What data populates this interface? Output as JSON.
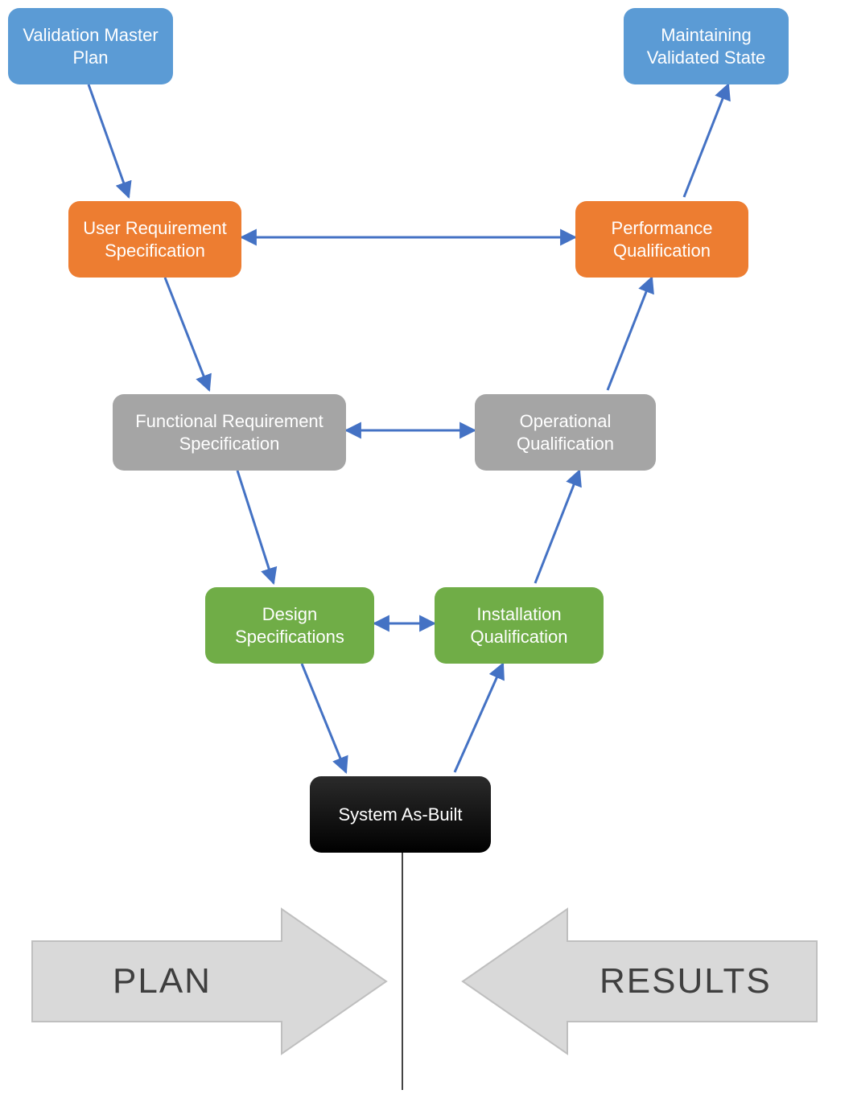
{
  "boxes": {
    "vmp": {
      "label": "Validation Master Plan"
    },
    "urs": {
      "label": "User Requirement Specification"
    },
    "frs": {
      "label": "Functional Requirement Specification"
    },
    "ds": {
      "label": "Design Specifications"
    },
    "sab": {
      "label": "System As-Built"
    },
    "iq": {
      "label": "Installation Qualification"
    },
    "oq": {
      "label": "Operational Qualification"
    },
    "pq": {
      "label": "Performance Qualification"
    },
    "mvs": {
      "label": "Maintaining Validated State"
    }
  },
  "labels": {
    "plan": "PLAN",
    "results": "RESULTS"
  },
  "colors": {
    "arrow": "#4472C4",
    "big_arrow_fill": "#D9D9D9",
    "big_arrow_stroke": "#BFBFBF"
  }
}
